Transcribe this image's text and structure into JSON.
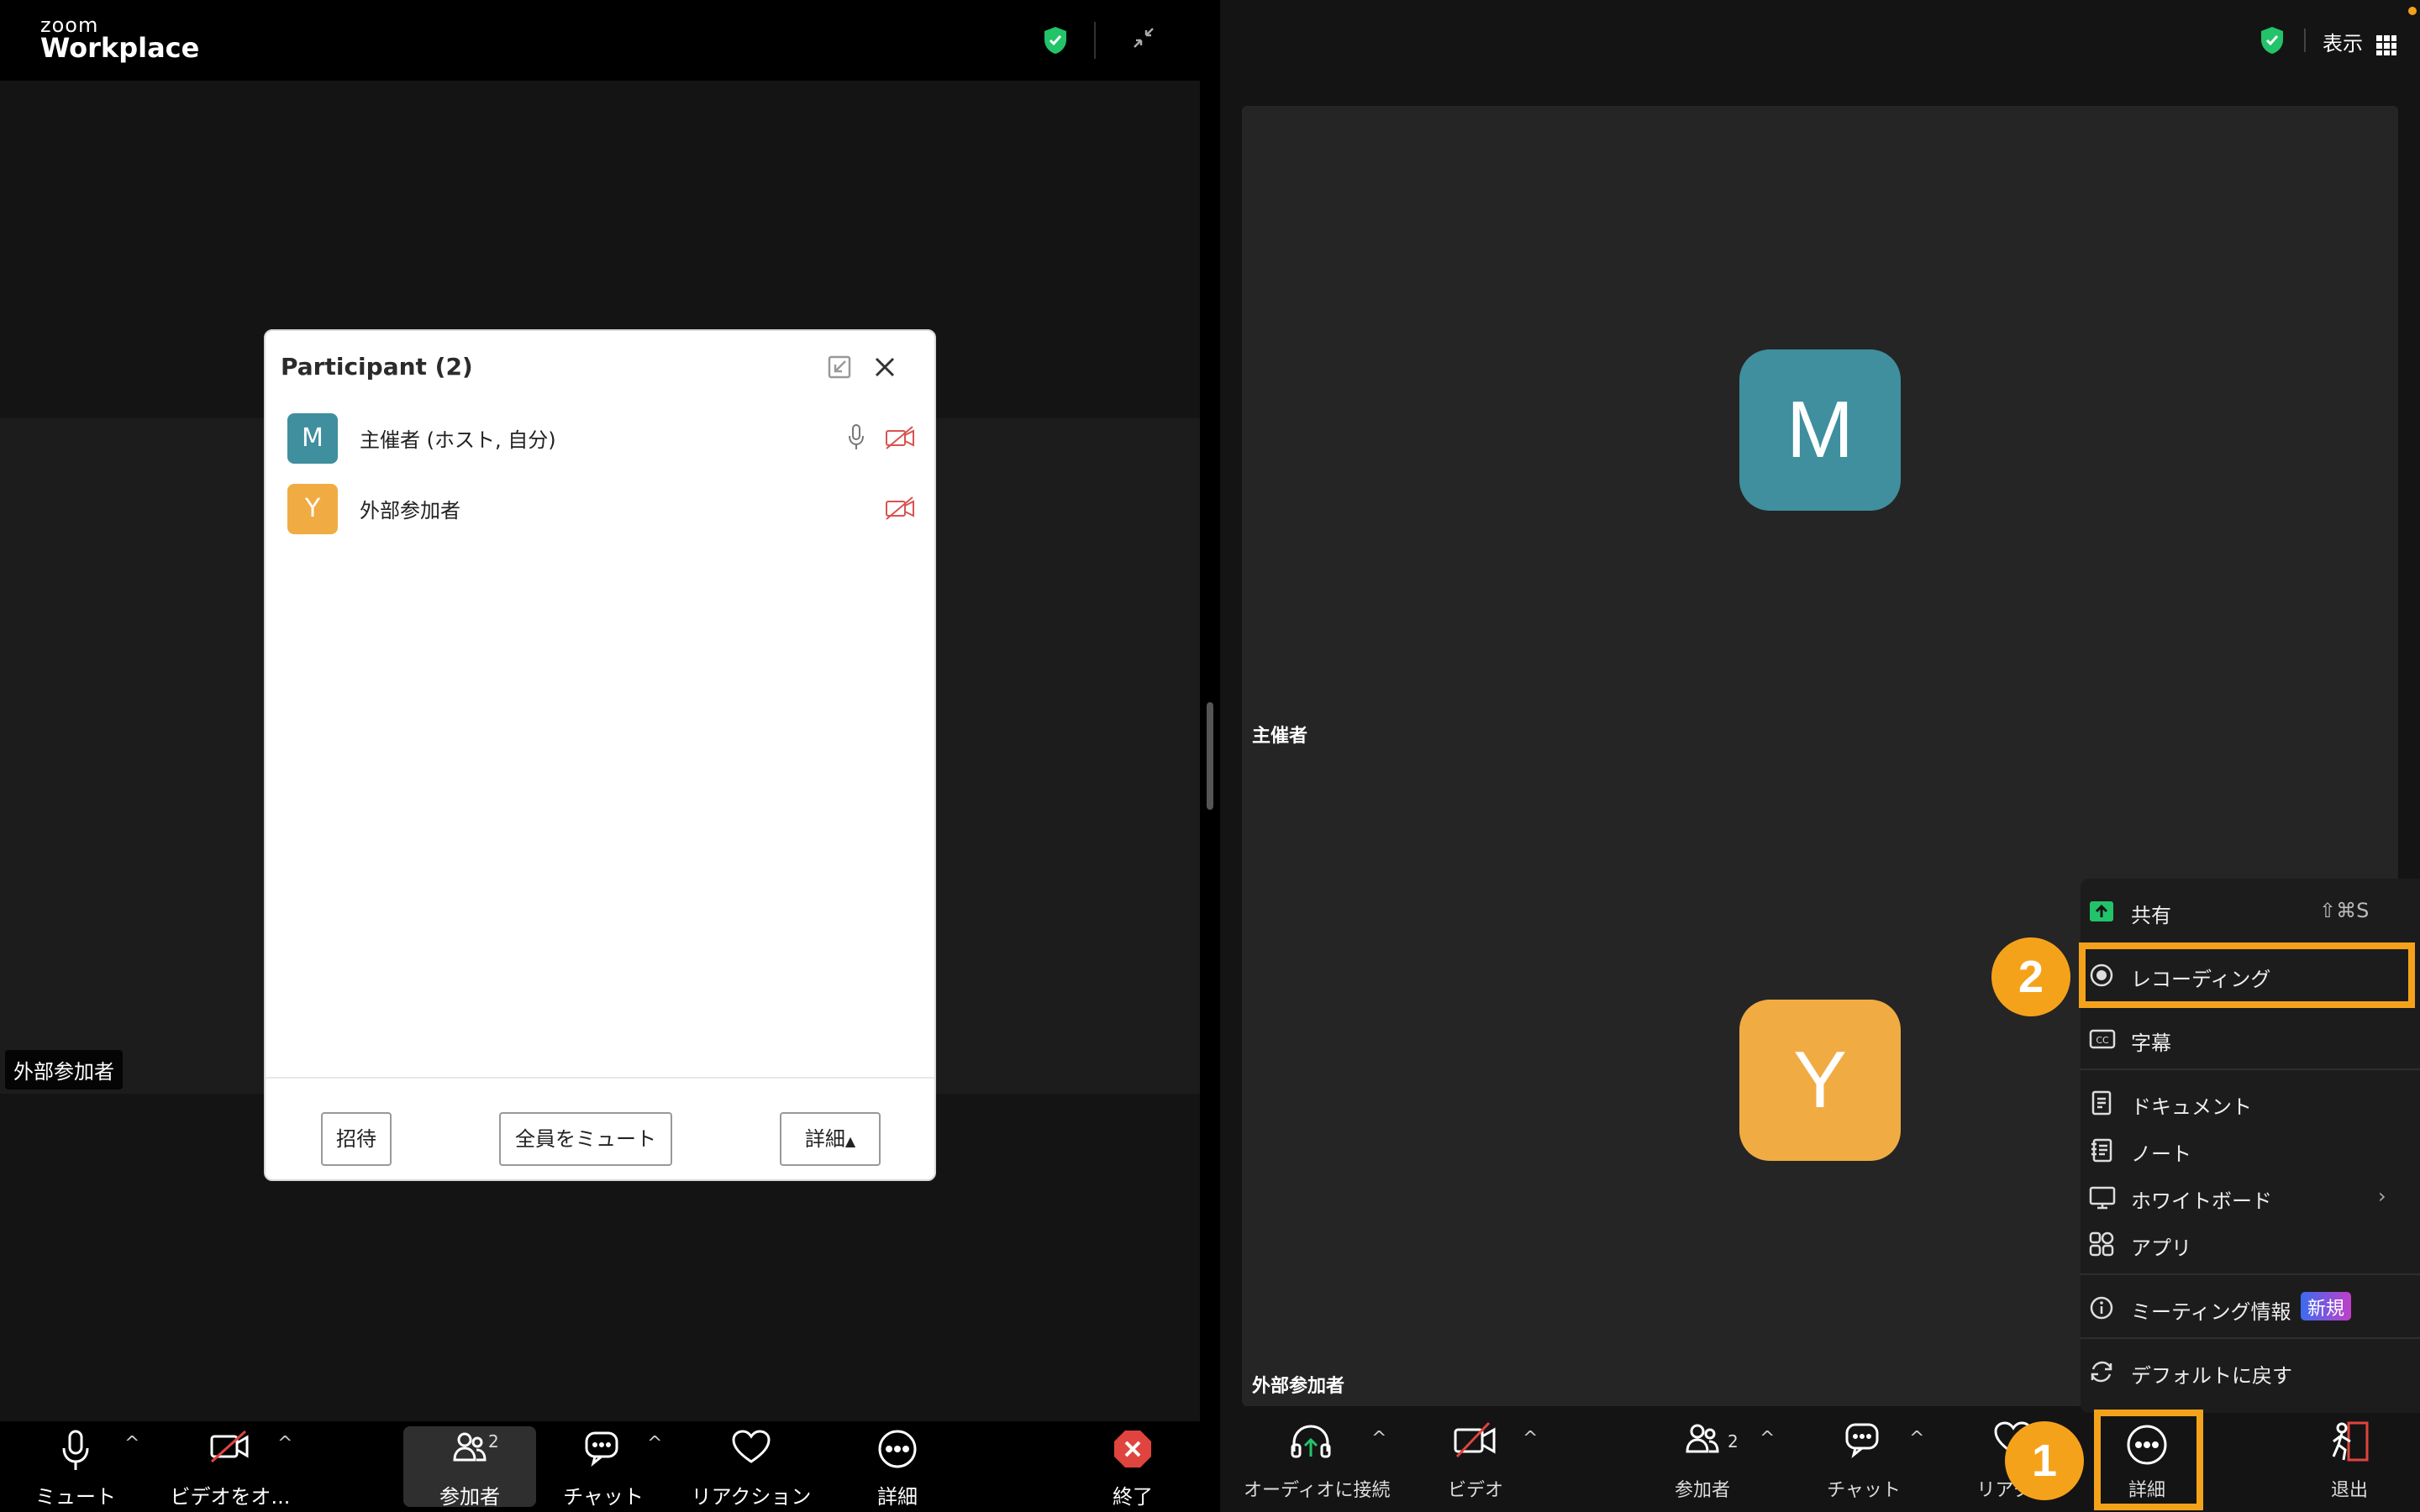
{
  "left_window": {
    "brand_small": "zoom",
    "brand_large": "Workplace",
    "tile_label": "外部参加者",
    "toolbar": {
      "mute": "ミュート",
      "video": "ビデオをオ...",
      "participants": "参加者",
      "participants_count": "2",
      "chat": "チャット",
      "reaction": "リアクション",
      "more": "詳細",
      "end": "終了"
    }
  },
  "participants_panel": {
    "title": "Participant (2)",
    "participants": [
      {
        "initial": "M",
        "name": "主催者 (ホスト, 自分)",
        "color": "#3f8f9e"
      },
      {
        "initial": "Y",
        "name": "外部参加者",
        "color": "#f0ac43"
      }
    ],
    "buttons": {
      "invite": "招待",
      "mute_all": "全員をミュート",
      "more": "詳細"
    }
  },
  "right_window": {
    "view_label": "表示",
    "host_tile_label": "主催者",
    "guest_tile_label": "外部参加者",
    "host_initial": "M",
    "guest_initial": "Y",
    "host_color": "#3f8f9e",
    "guest_color": "#f0ac43",
    "toolbar": {
      "audio": "オーディオに接続",
      "video": "ビデオ",
      "participants": "参加者",
      "participants_count": "2",
      "chat": "チャット",
      "reaction": "リアクシ",
      "more": "詳細",
      "leave": "退出"
    },
    "more_menu": {
      "share": "共有",
      "share_shortcut": "⇧⌘S",
      "recording": "レコーディング",
      "captions": "字幕",
      "documents": "ドキュメント",
      "notes": "ノート",
      "whiteboard": "ホワイトボード",
      "apps": "アプリ",
      "meeting_info": "ミーティング情報",
      "new_badge": "新規",
      "reset": "デフォルトに戻す"
    }
  },
  "annotations": {
    "step1": "1",
    "step2": "2",
    "highlight_color": "#f5a21b"
  }
}
